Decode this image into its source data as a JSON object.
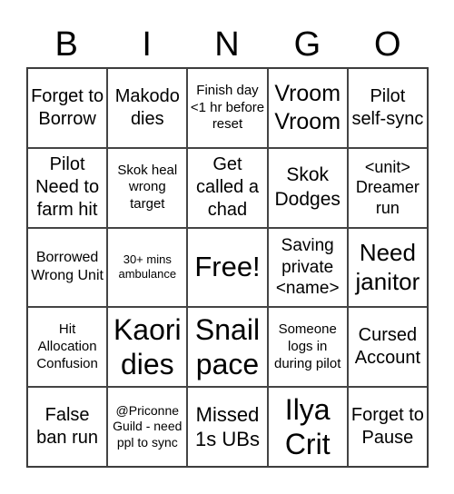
{
  "header": [
    "B",
    "I",
    "N",
    "G",
    "O"
  ],
  "cells": [
    "Forget to Borrow",
    "Makodo dies",
    "Finish day <1 hr before reset",
    "Vroom Vroom",
    "Pilot self-sync",
    "Pilot Need to farm hit",
    "Skok heal wrong target",
    "Get called a chad",
    "Skok Dodges",
    "<unit> Dreamer run",
    "Borrowed Wrong Unit",
    "30+ mins ambulance",
    "Free!",
    "Saving private <name>",
    "Need janitor",
    "Hit Allocation Confusion",
    "Kaori dies",
    "Snail pace",
    "Someone logs in during pilot",
    "Cursed Account",
    "False ban run",
    "@Priconne Guild - need ppl to sync",
    "Missed 1s UBs",
    "Ilya Crit",
    "Forget to Pause"
  ]
}
